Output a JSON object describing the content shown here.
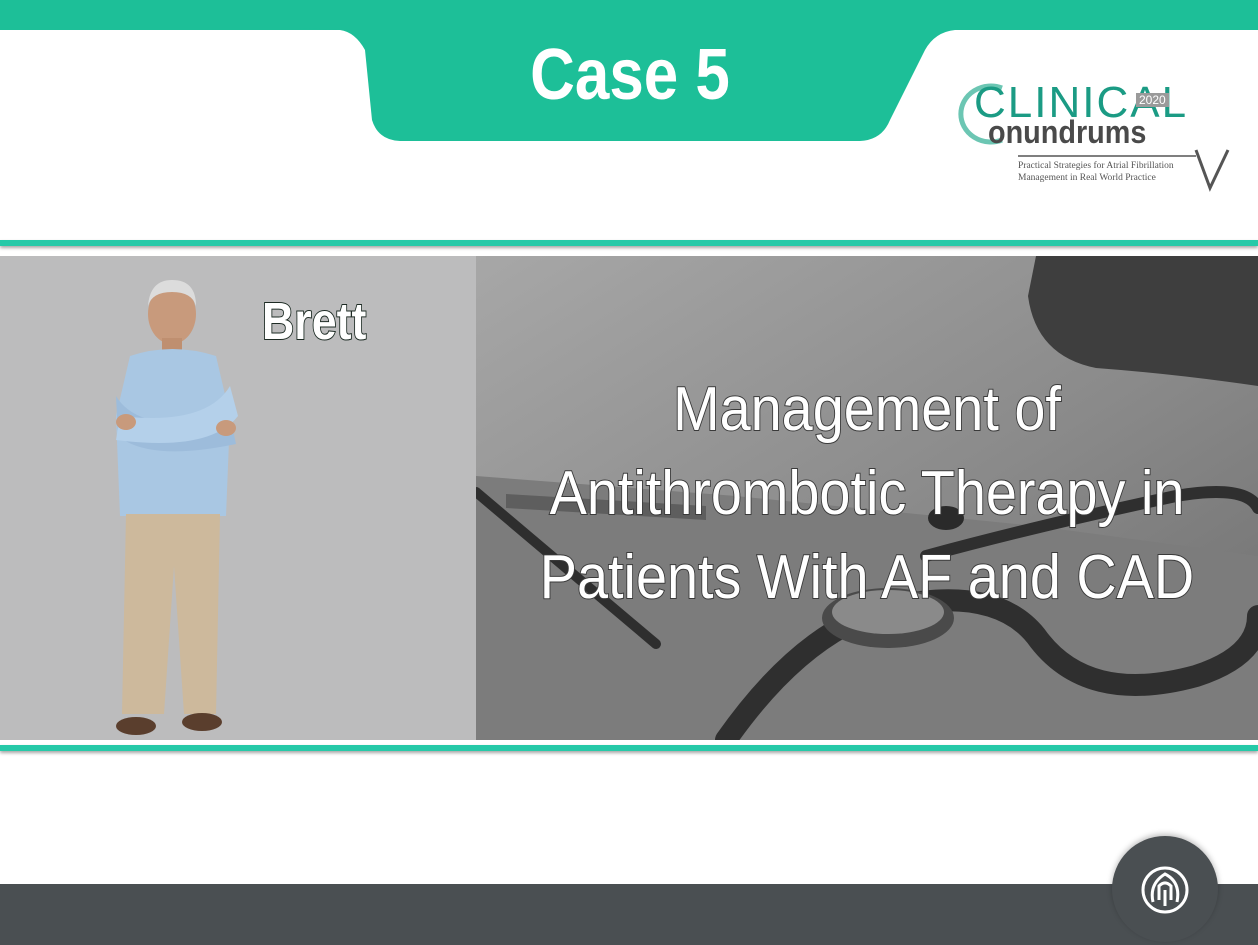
{
  "slide": {
    "case_title": "Case 5",
    "patient_name": "Brett",
    "topic_lines": [
      "Management of",
      "Antithrombotic Therapy in",
      "Patients With AF and CAD"
    ]
  },
  "logo": {
    "clinical": "CLINICAL",
    "year": "2020",
    "conundrums": "onundrums",
    "tagline_line1": "Practical Strategies for Atrial Fibrillation",
    "tagline_line2": "Management in Real World Practice"
  },
  "colors": {
    "accent_teal": "#26c9a8",
    "banner_teal": "#1dbf98",
    "footer_gray": "#4a4f52",
    "left_panel_gray": "#bcbcbd"
  },
  "icons": {
    "footer_badge": "brand-emblem-icon"
  }
}
